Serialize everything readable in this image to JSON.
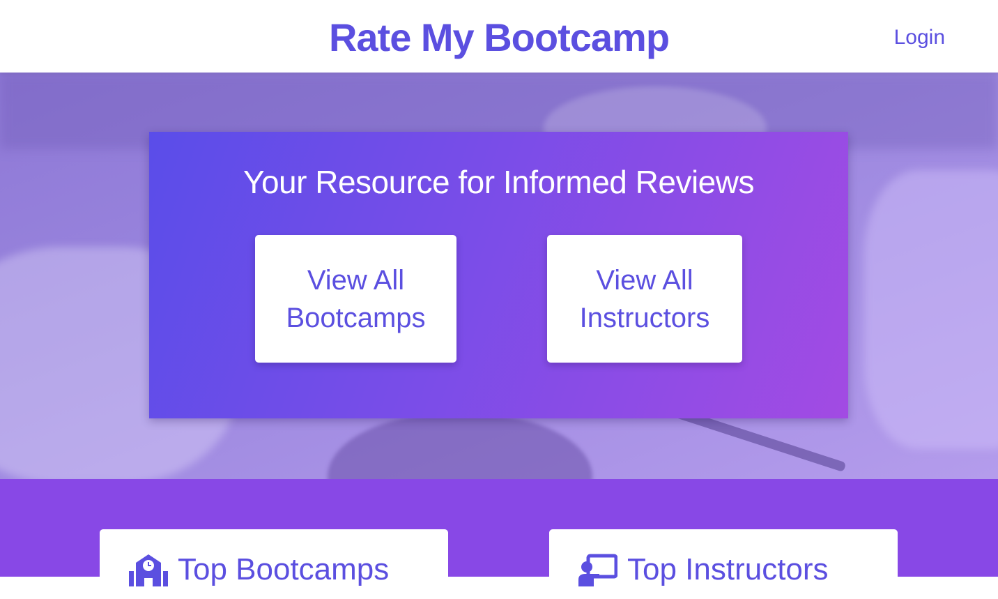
{
  "header": {
    "brand": "Rate My Bootcamp",
    "login_label": "Login"
  },
  "hero": {
    "title": "Your Resource for Informed Reviews",
    "buttons": [
      {
        "line1": "View All",
        "line2": "Bootcamps"
      },
      {
        "line1": "View All",
        "line2": "Instructors"
      }
    ]
  },
  "sections": [
    {
      "title": "Top Bootcamps",
      "icon": "school-icon"
    },
    {
      "title": "Top Instructors",
      "icon": "chalkboard-teacher-icon"
    }
  ],
  "colors": {
    "brand": "#5b4fe0",
    "band": "#8848e6",
    "panel_start": "#5a4de9",
    "panel_end": "#a24be3"
  }
}
